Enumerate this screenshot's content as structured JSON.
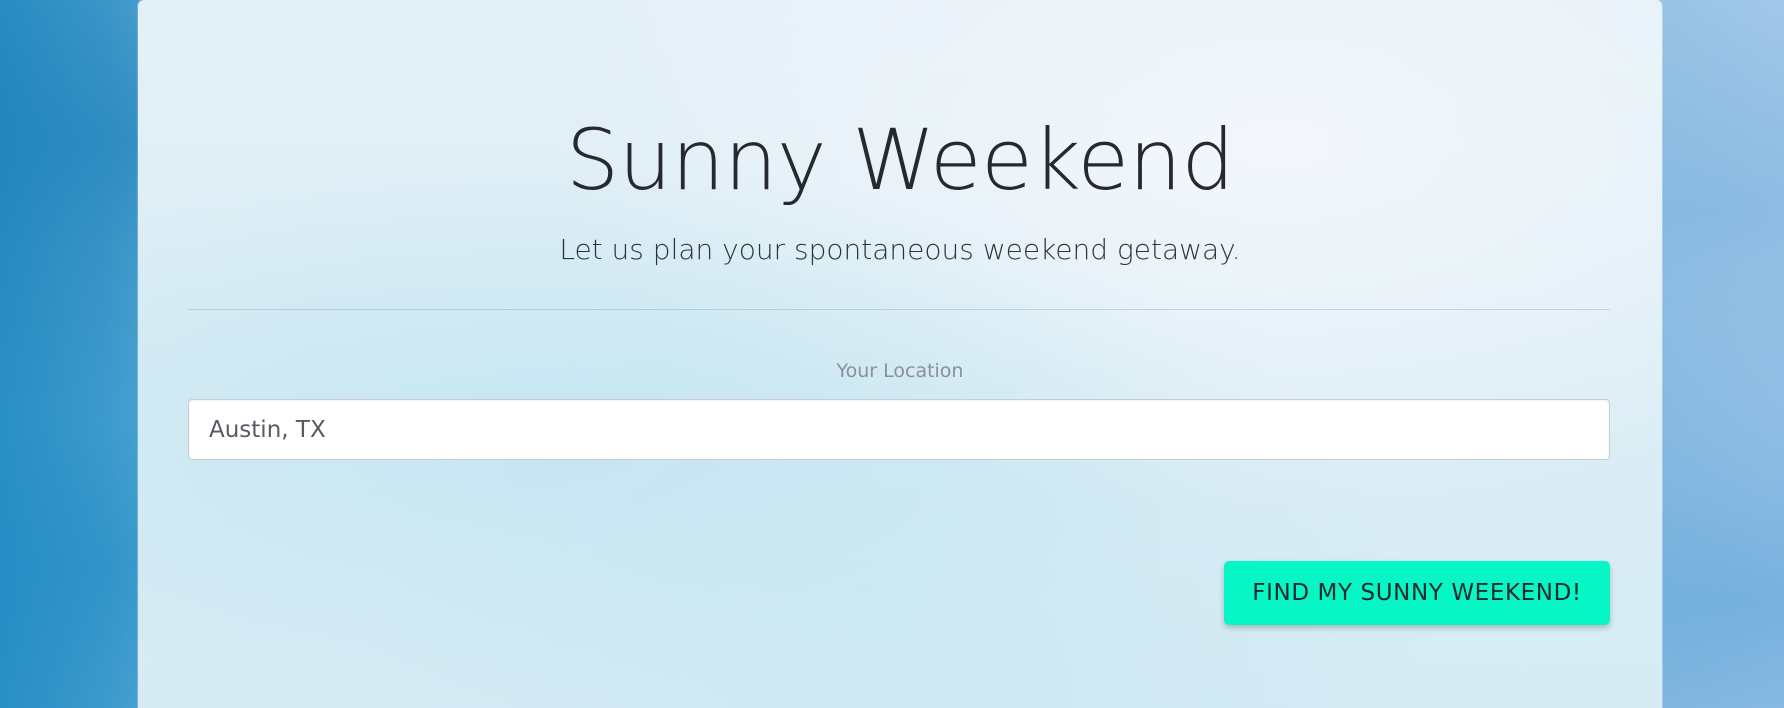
{
  "header": {
    "title": "Sunny Weekend",
    "subtitle": "Let us plan your spontaneous weekend getaway."
  },
  "form": {
    "location_label": "Your Location",
    "location_value": "Austin, TX",
    "submit_label": "FIND MY SUNNY WEEKEND!"
  },
  "colors": {
    "button_bg": "#06f6c6",
    "title_text": "#262a30",
    "page_bg": "#2e92c6"
  }
}
